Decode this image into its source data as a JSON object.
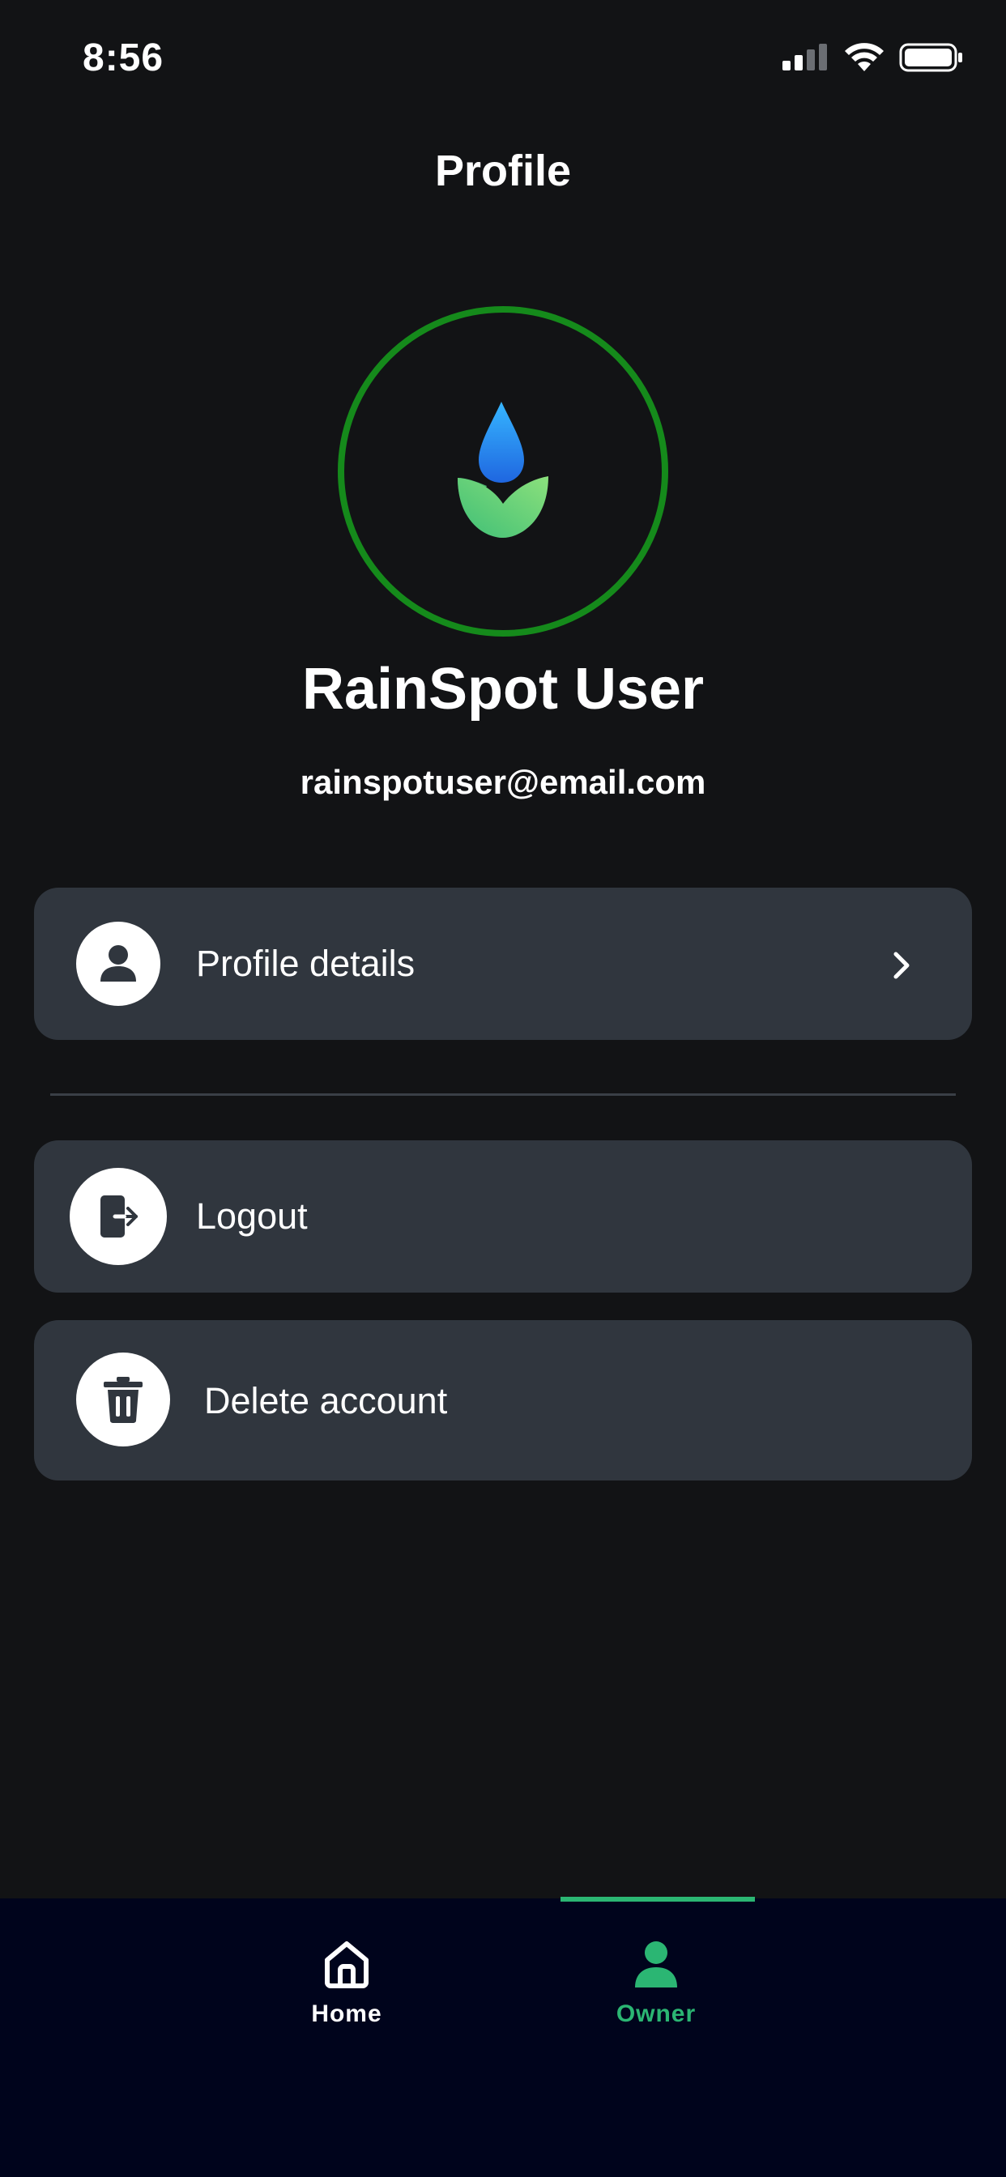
{
  "status_bar": {
    "time": "8:56"
  },
  "header": {
    "title": "Profile"
  },
  "profile": {
    "name": "RainSpot User",
    "email": "rainspotuser@email.com"
  },
  "menu": {
    "profile_details": "Profile details",
    "logout": "Logout",
    "delete_account": "Delete account"
  },
  "tabs": [
    {
      "label": "Home",
      "icon": "home-icon",
      "active": false
    },
    {
      "label": "Owner",
      "icon": "person-icon",
      "active": true
    }
  ],
  "colors": {
    "background": "#121315",
    "card": "#30363e",
    "ring": "#158a1b",
    "accent": "#2bb673",
    "tabbar": "#00041c"
  }
}
